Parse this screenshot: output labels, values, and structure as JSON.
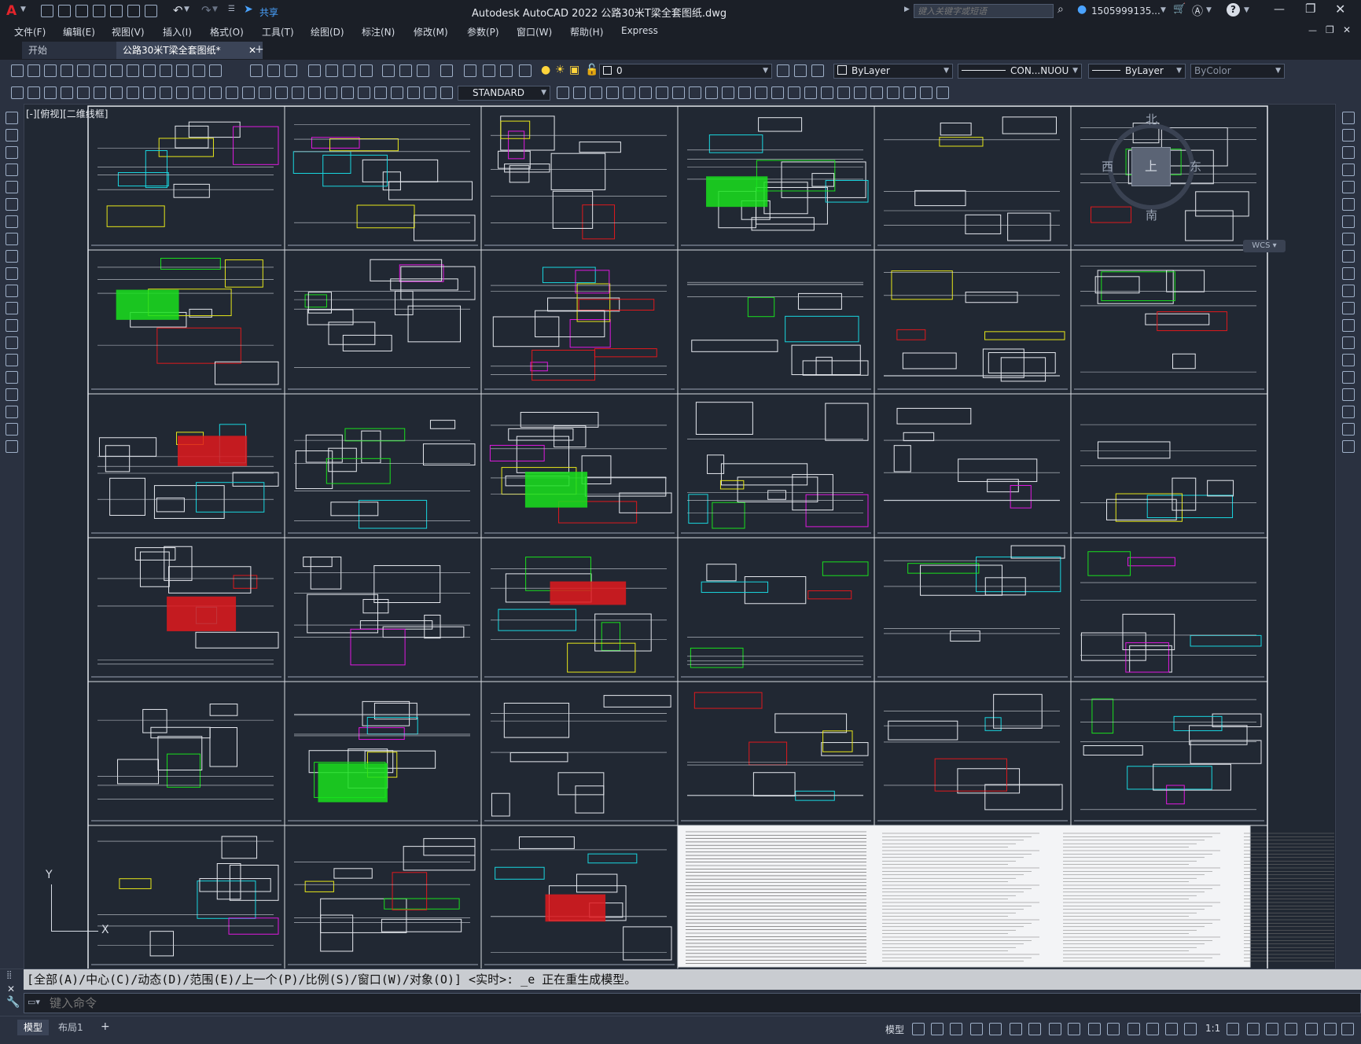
{
  "app": {
    "logo": "A",
    "title": "Autodesk AutoCAD 2022    公路30米T梁全套图纸.dwg",
    "share_label": "共享",
    "search_placeholder": "键入关键字或短语",
    "user": "1505999135...",
    "help": "?"
  },
  "menu": [
    "文件(F)",
    "编辑(E)",
    "视图(V)",
    "插入(I)",
    "格式(O)",
    "工具(T)",
    "绘图(D)",
    "标注(N)",
    "修改(M)",
    "参数(P)",
    "窗口(W)",
    "帮助(H)",
    "Express"
  ],
  "tabs": {
    "start": "开始",
    "active": "公路30米T梁全套图纸*",
    "add": "+"
  },
  "layer": {
    "name": "0",
    "color": "ByLayer",
    "linetype": "CON...NUOU",
    "lineweight": "ByLayer",
    "plotstyle": "ByColor"
  },
  "textstyle": "STANDARD",
  "viewport_label": "[-][俯视][二维线框]",
  "viewcube": {
    "n": "北",
    "s": "南",
    "e": "东",
    "w": "西",
    "face": "上",
    "wcs": "WCS"
  },
  "ucs": {
    "y": "Y",
    "x": "X"
  },
  "command": {
    "history": "[全部(A)/中心(C)/动态(D)/范围(E)/上一个(P)/比例(S)/窗口(W)/对象(O)] <实时>: _e 正在重生成模型。",
    "placeholder": "键入命令"
  },
  "status": {
    "model_tab": "模型",
    "layout_tab": "布局1",
    "add": "+",
    "model_label": "模型",
    "scale": "1:1"
  },
  "colors": {
    "background": "#212833",
    "sheet_border": "#d7dbe2",
    "accent_red": "#e0191d",
    "accent_green": "#19e01d",
    "accent_magenta": "#e019e0",
    "accent_yellow": "#e7e71a",
    "accent_cyan": "#19d7e0"
  }
}
